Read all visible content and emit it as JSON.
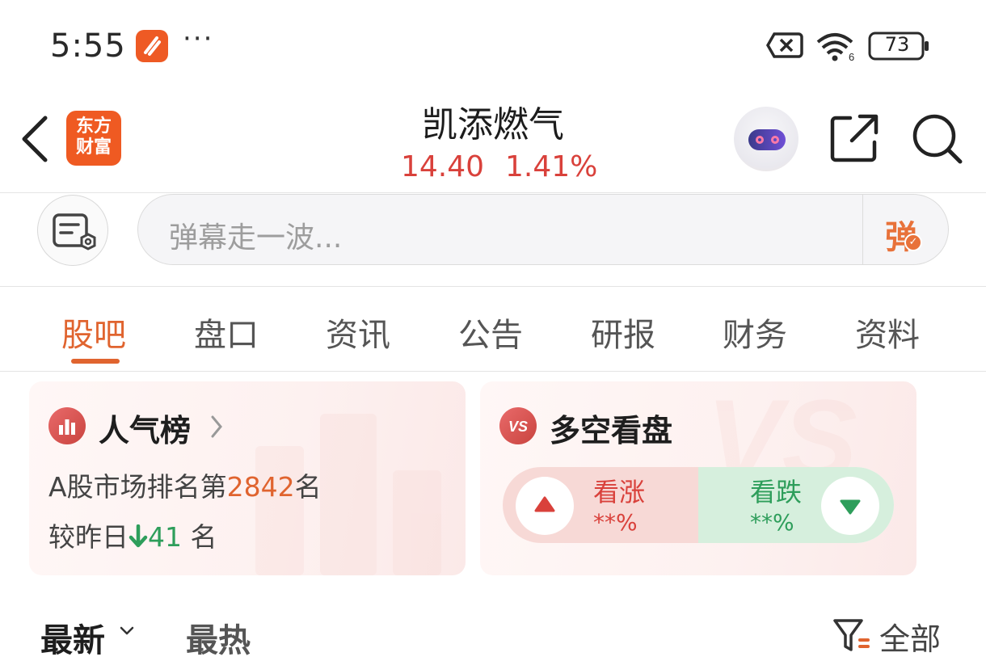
{
  "status_bar": {
    "time": "5:55",
    "more": "···",
    "battery": "73",
    "icons": [
      "app-notification-icon",
      "no-sim-icon",
      "wifi-icon",
      "battery-icon"
    ]
  },
  "header": {
    "brand": {
      "line1": "东方",
      "line2": "财富"
    },
    "stock_name": "凯添燃气",
    "price": "14.40",
    "change_pct": "1.41%",
    "price_color": "#d9413b",
    "icons": [
      "back-icon",
      "robot-assistant-icon",
      "share-icon",
      "search-icon"
    ]
  },
  "danmaku": {
    "placeholder": "弹幕走一波...",
    "toggle_label": "弹"
  },
  "tabs": [
    {
      "label": "股吧",
      "active": true
    },
    {
      "label": "盘口"
    },
    {
      "label": "资讯"
    },
    {
      "label": "公告"
    },
    {
      "label": "研报"
    },
    {
      "label": "财务"
    },
    {
      "label": "资料"
    }
  ],
  "popularity": {
    "title": "人气榜",
    "rank_prefix": "A股市场排名第",
    "rank_value": "2842",
    "rank_suffix": "名",
    "cmp_prefix": "较昨日",
    "cmp_value": "41",
    "cmp_suffix": "名",
    "cmp_direction": "down"
  },
  "bull_bear": {
    "title": "多空看盘",
    "icon_text": "VS",
    "up_label": "看涨",
    "up_pct": "**%",
    "down_label": "看跌",
    "down_pct": "**%"
  },
  "filter_bar": {
    "sort_latest": "最新",
    "sort_hot": "最热",
    "filter_label": "全部"
  },
  "colors": {
    "accent": "#e0642f",
    "rise": "#d9413b",
    "fall": "#2e9e5b"
  }
}
